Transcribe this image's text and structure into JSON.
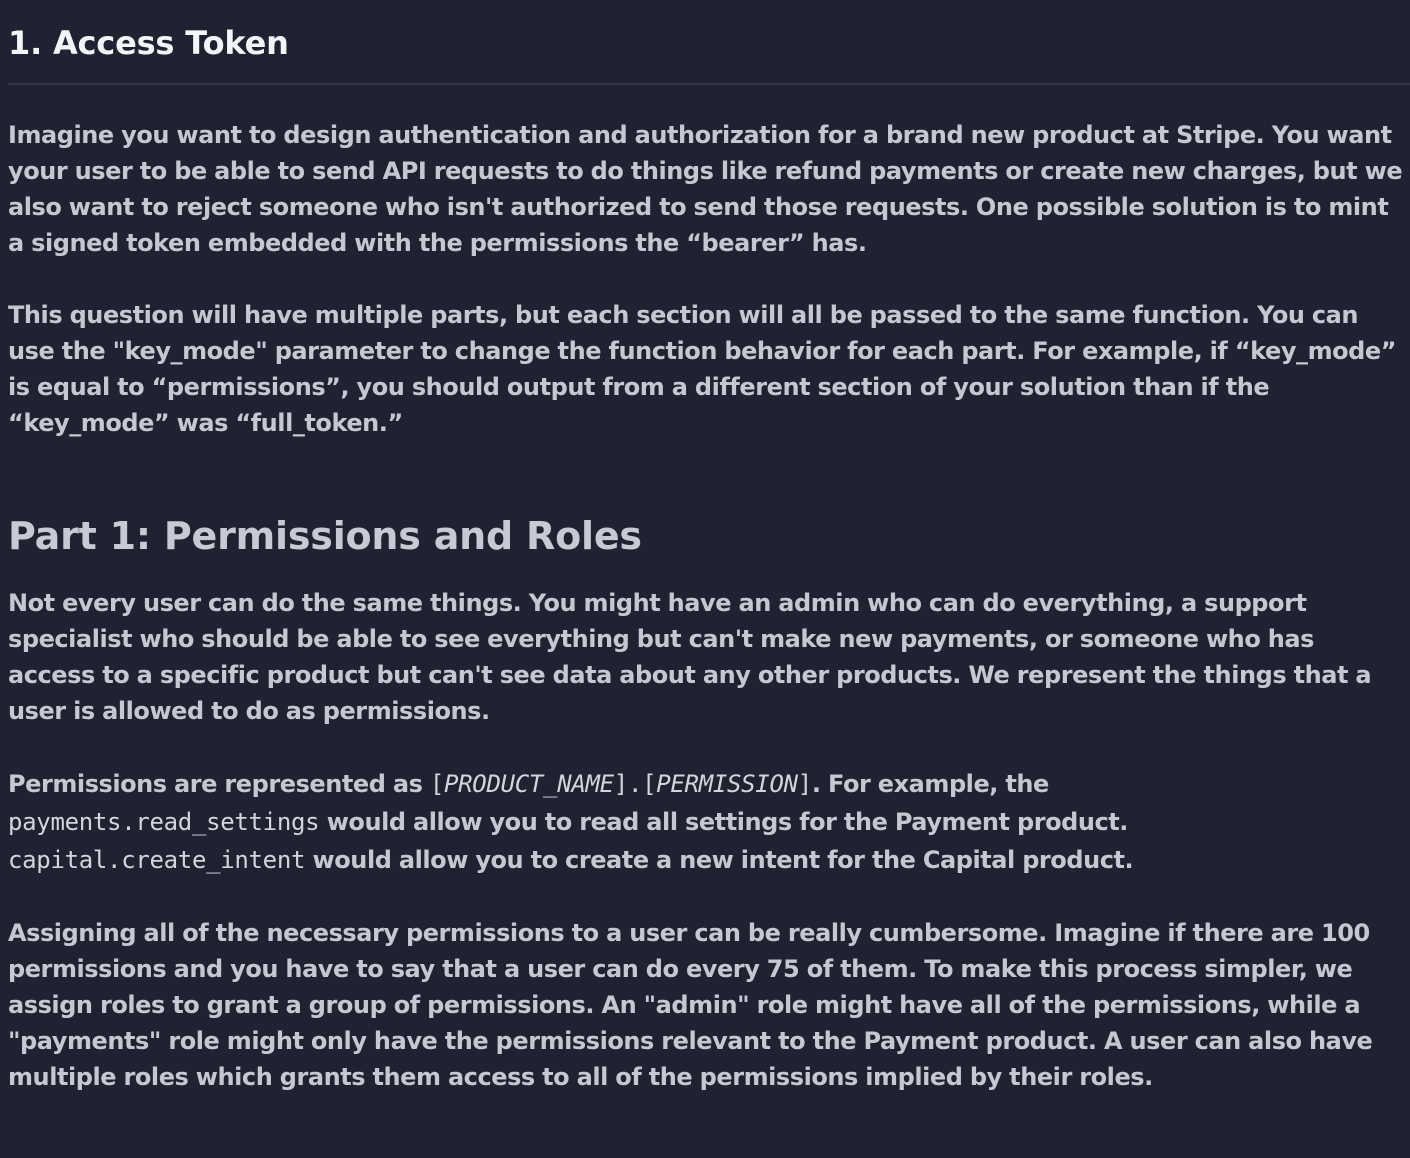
{
  "title": "1. Access Token",
  "intro": {
    "paragraph1": "Imagine you want to design authentication and authorization for a brand new product at Stripe. You want your user to be able to send API requests to do things like refund payments or create new charges, but we also want to reject someone who isn't authorized to send those requests. One possible solution is to mint a signed token embedded with the permissions the “bearer” has.",
    "paragraph2": "This question will have multiple parts, but each section will all be passed to the same function. You can use the \"key_mode\" parameter to change the function behavior for each part. For example, if “key_mode” is equal to “permissions”, you should output from a different section of your solution than if the “key_mode” was “full_token.”"
  },
  "part1": {
    "heading": "Part 1: Permissions and Roles",
    "paragraph1": "Not every user can do the same things. You might have an admin who can do everything, a support specialist who should be able to see everything but can't make new payments, or someone who has access to a specific product but can't see data about any other products. We represent the things that a user is allowed to do as permissions.",
    "permissions_paragraph": {
      "lead": "Permissions are represented as ",
      "format_open1": "[",
      "format_product": "PRODUCT_NAME",
      "format_sep": "].[",
      "format_permission": "PERMISSION",
      "format_close": "]",
      "after_format": ". For example, the",
      "example1_code": "payments.read_settings",
      "example1_text": " would allow you to read all settings for the Payment product.",
      "example2_code": "capital.create_intent",
      "example2_text": " would allow you to create a new intent for the Capital product."
    },
    "paragraph3": "Assigning all of the necessary permissions to a user can be really cumbersome. Imagine if there are 100 permissions and you have to say that a user can do every 75 of them. To make this process simpler, we assign roles to grant a group of permissions. An \"admin\" role might have all of the permissions, while a \"payments\" role might only have the permissions relevant to the Payment product. A user can also have multiple roles which grants them access to all of the permissions implied by their roles."
  }
}
